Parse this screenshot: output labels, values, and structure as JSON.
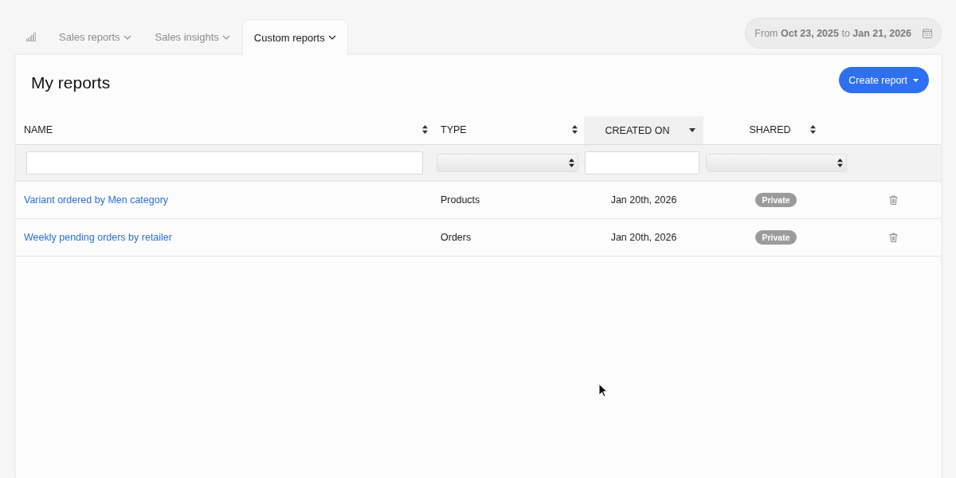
{
  "nav": {
    "tabs": [
      {
        "label": "Sales reports",
        "selected": false
      },
      {
        "label": "Sales insights",
        "selected": false
      },
      {
        "label": "Custom reports",
        "selected": true
      }
    ]
  },
  "date_range": {
    "text": "From **Oct 23, 2025** to **Jan 21, 2026**"
  },
  "reports": {
    "title": "My reports",
    "create_button": "Create report",
    "table": {
      "columns": [
        {
          "label": "NAME",
          "sorted": false
        },
        {
          "label": "TYPE",
          "sorted": false
        },
        {
          "label": "CREATED ON",
          "sorted": true
        },
        {
          "label": "SHARED",
          "sorted": false
        }
      ],
      "filters": [
        {
          "kind": "text"
        },
        {
          "kind": "select"
        },
        {
          "kind": "text"
        },
        {
          "kind": "select"
        }
      ],
      "rows": [
        {
          "name": "Variant ordered by Men category",
          "type": "Products",
          "created_on": "Jan 20th, 2026",
          "shared": "Private"
        },
        {
          "name": "Weekly pending orders by retailer",
          "type": "Orders",
          "created_on": "Jan 20th, 2026",
          "shared": "Private"
        }
      ]
    }
  }
}
